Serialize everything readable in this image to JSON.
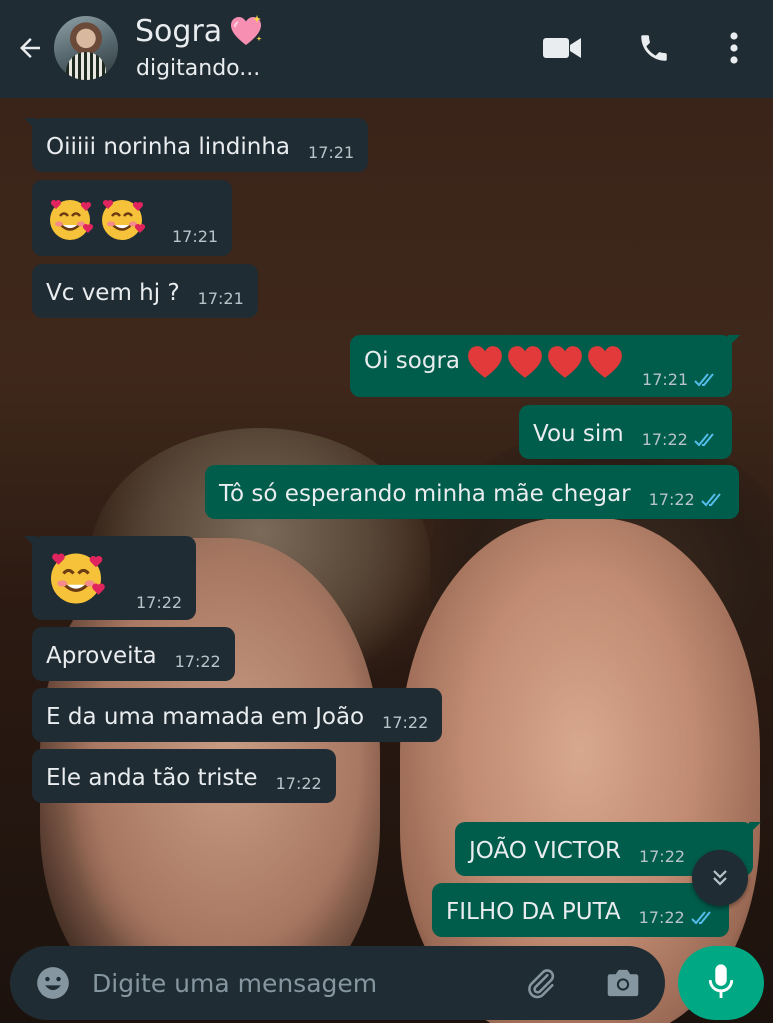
{
  "header": {
    "contact_name": "Sogra",
    "status": "digitando...",
    "icons": [
      "back-arrow-icon",
      "sparkling-heart-icon",
      "video-call-icon",
      "phone-icon",
      "more-vert-icon"
    ]
  },
  "messages": [
    {
      "dir": "in",
      "text": "Oiiiii norinha lindinha",
      "time": "17:21"
    },
    {
      "dir": "in",
      "emoji": [
        "smiling-face-with-hearts-icon",
        "smiling-face-with-hearts-icon"
      ],
      "time": "17:21"
    },
    {
      "dir": "in",
      "text": "Vc vem hj ?",
      "time": "17:21"
    },
    {
      "dir": "out",
      "text": "Oi sogra",
      "emoji": [
        "red-heart-icon",
        "red-heart-icon",
        "red-heart-icon",
        "red-heart-icon"
      ],
      "time": "17:21",
      "ticks": "read"
    },
    {
      "dir": "out",
      "text": "Vou sim",
      "time": "17:22",
      "ticks": "read"
    },
    {
      "dir": "out",
      "text": "Tô só esperando minha mãe chegar",
      "time": "17:22",
      "ticks": "read"
    },
    {
      "dir": "in",
      "emoji": [
        "smiling-face-with-hearts-icon"
      ],
      "time": "17:22"
    },
    {
      "dir": "in",
      "text": "Aproveita",
      "time": "17:22"
    },
    {
      "dir": "in",
      "text": "E da uma mamada em João",
      "time": "17:22"
    },
    {
      "dir": "in",
      "text": "Ele anda tão triste",
      "time": "17:22"
    },
    {
      "dir": "out",
      "text": "JOÃO VICTOR",
      "time": "17:22"
    },
    {
      "dir": "out",
      "text": "FILHO DA PUTA",
      "time": "17:22",
      "ticks": "read"
    }
  ],
  "input": {
    "placeholder": "Digite uma mensagem",
    "icons": [
      "emoji-icon",
      "attach-icon",
      "camera-icon",
      "mic-icon"
    ]
  },
  "colors": {
    "header_bg": "#202c33",
    "incoming_bubble": "#202c33",
    "outgoing_bubble": "#005c4b",
    "read_ticks": "#53bdeb",
    "mic_button": "#00a884"
  }
}
